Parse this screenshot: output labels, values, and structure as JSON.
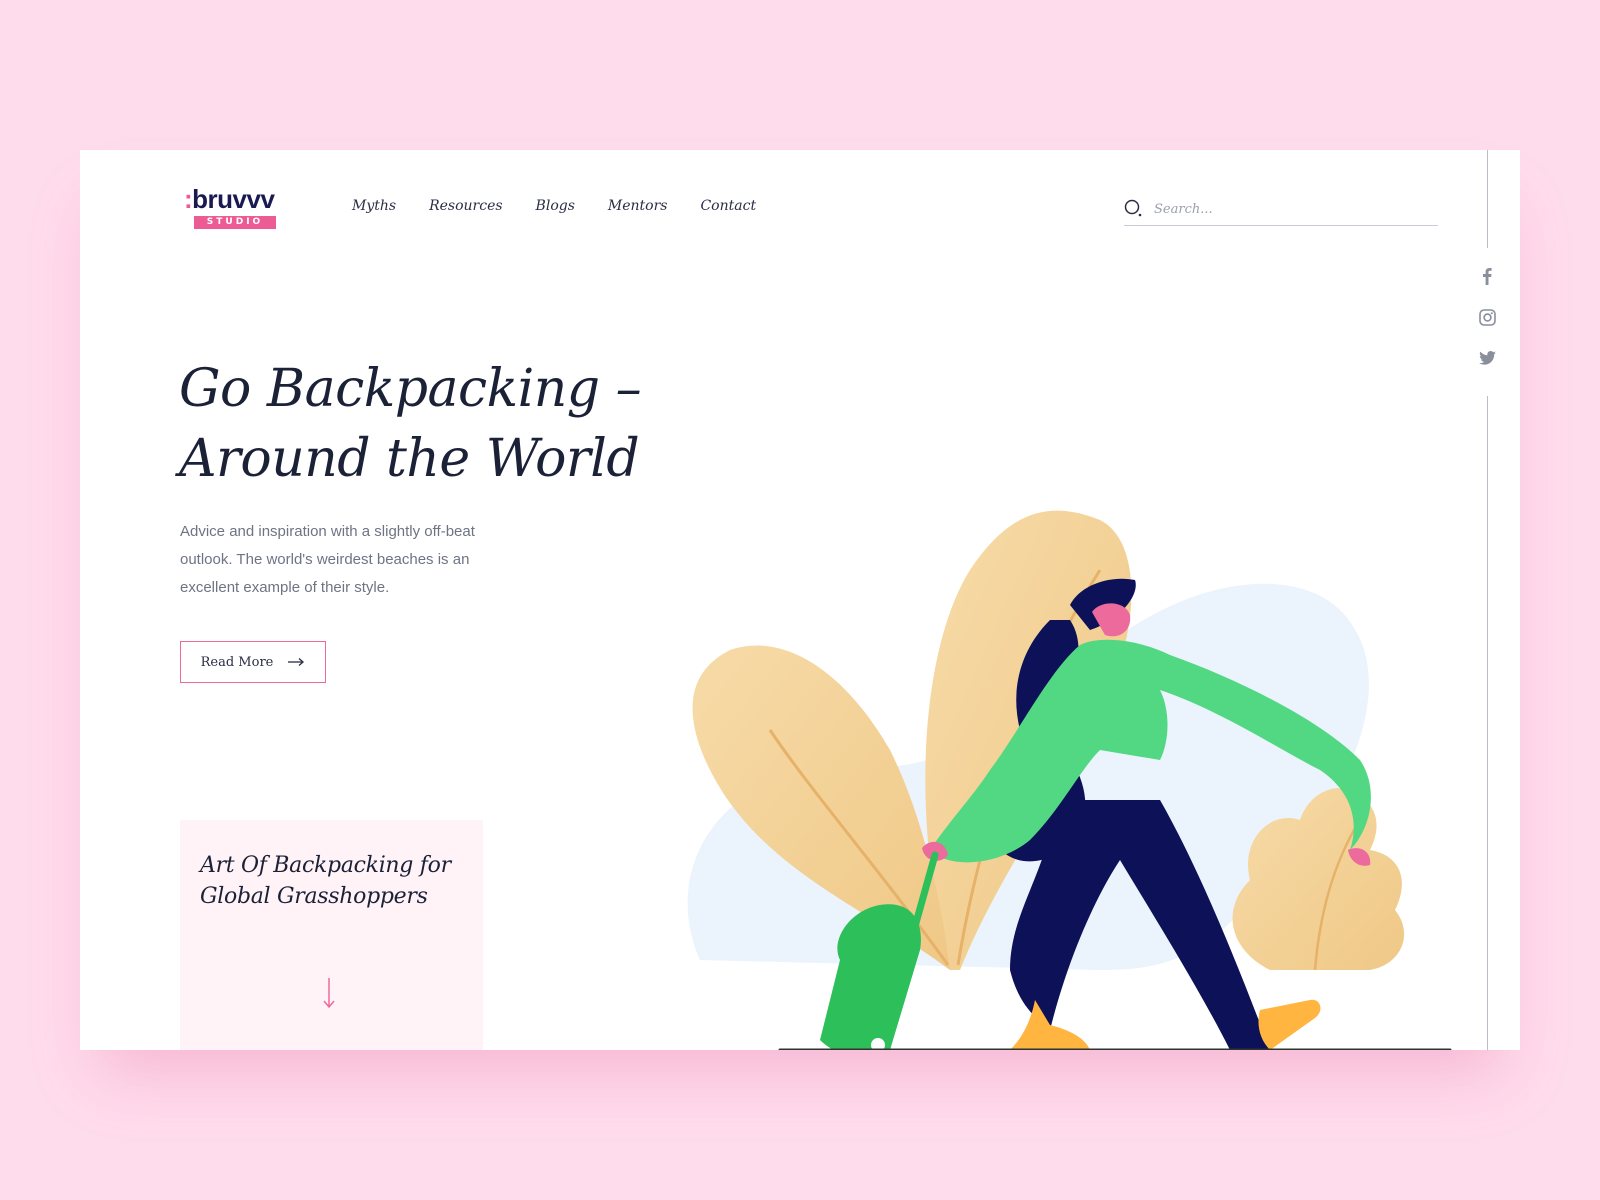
{
  "brand": {
    "logo_prefix": ":",
    "logo_name": "bruvvv",
    "logo_sub": "STUDIO"
  },
  "nav": {
    "items": [
      {
        "label": "Myths"
      },
      {
        "label": "Resources"
      },
      {
        "label": "Blogs"
      },
      {
        "label": "Mentors"
      },
      {
        "label": "Contact"
      }
    ]
  },
  "search": {
    "placeholder": "Search..."
  },
  "social": {
    "icons": [
      "facebook-icon",
      "instagram-icon",
      "twitter-icon"
    ]
  },
  "hero": {
    "title": "Go Backpacking –\nAround the World",
    "description": "Advice and inspiration with a slightly off-beat outlook. The world's weirdest beaches is an excellent example of their style.",
    "button_label": "Read More"
  },
  "feature": {
    "title": "Art Of Backpacking for\nGlobal Grasshoppers"
  },
  "colors": {
    "background": "#ffdcec",
    "accent": "#ec5b94",
    "text_dark": "#1b2136",
    "muted": "#6e7484",
    "leaf": "#f5d7a0",
    "sweater": "#52d883",
    "pants": "#0d1157"
  }
}
